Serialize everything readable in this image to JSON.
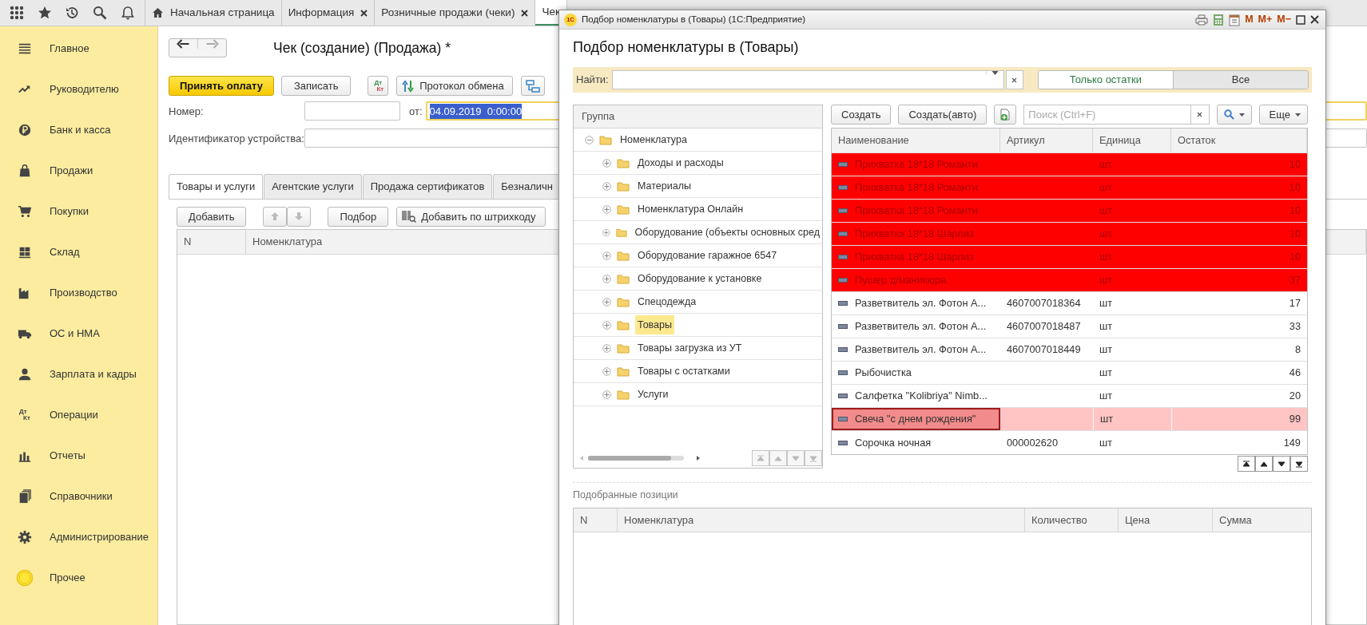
{
  "top_bar": {
    "tabs": [
      {
        "label": "Начальная страница",
        "selected": false,
        "closable": false,
        "home": true
      },
      {
        "label": "Информация",
        "selected": false,
        "closable": true,
        "home": false
      },
      {
        "label": "Розничные продажи (чеки)",
        "selected": false,
        "closable": true,
        "home": false
      },
      {
        "label": "Чек",
        "selected": true,
        "closable": false,
        "home": false
      }
    ]
  },
  "sidebar": {
    "items": [
      {
        "label": "Главное"
      },
      {
        "label": "Руководителю"
      },
      {
        "label": "Банк и касса"
      },
      {
        "label": "Продажи"
      },
      {
        "label": "Покупки"
      },
      {
        "label": "Склад"
      },
      {
        "label": "Производство"
      },
      {
        "label": "ОС и НМА"
      },
      {
        "label": "Зарплата и кадры"
      },
      {
        "label": "Операции",
        "icon_text": [
          "Дт",
          "Кт"
        ]
      },
      {
        "label": "Отчеты"
      },
      {
        "label": "Справочники"
      },
      {
        "label": "Администрирование"
      },
      {
        "label": "Прочее"
      }
    ]
  },
  "form": {
    "title": "Чек (создание) (Продажа) *",
    "commands": [
      {
        "kind": "primary",
        "label": "Принять оплату"
      },
      {
        "kind": "button",
        "label": "Записать"
      },
      {
        "kind": "dtkt",
        "icon_text": [
          "Дт",
          "Кт"
        ]
      },
      {
        "kind": "icon-button",
        "label": "Протокол обмена"
      },
      {
        "kind": "icon"
      }
    ],
    "number_label": "Номер:",
    "date_label": "от:",
    "date_value": "04.09.2019  0:00:00",
    "device_label": "Идентификатор устройства:",
    "tabs": [
      {
        "label": "Товары и услуги",
        "selected": true
      },
      {
        "label": "Агентские услуги",
        "selected": false
      },
      {
        "label": "Продажа сертификатов",
        "selected": false
      },
      {
        "label": "Безналичн",
        "selected": false
      }
    ],
    "table_commands": {
      "add": "Добавить",
      "pick": "Подбор",
      "barcode": "Добавить по штрихкоду"
    },
    "table": {
      "columns": [
        "N",
        "Номенклатура"
      ]
    }
  },
  "dialog": {
    "window_title": "Подбор номенклатуры в  (Товары)  (1С:Предприятие)",
    "logo_text": "1С",
    "memory_buttons": [
      "M",
      "M+",
      "M−"
    ],
    "heading": "Подбор номенклатуры в  (Товары)",
    "find_label": "Найти:",
    "filter_options": [
      {
        "label": "Только остатки",
        "selected": false
      },
      {
        "label": "Все",
        "selected": true
      }
    ],
    "tree": {
      "header": "Группа",
      "root": {
        "label": "Номенклатура",
        "expanded": true,
        "selected": false,
        "children": [
          {
            "label": "Доходы и расходы",
            "expanded": false,
            "selected": false
          },
          {
            "label": "Материалы",
            "expanded": false,
            "selected": false
          },
          {
            "label": "Номенклатура Онлайн",
            "expanded": false,
            "selected": false
          },
          {
            "label": "Оборудование (объекты основных сред",
            "expanded": false,
            "selected": false
          },
          {
            "label": "Оборудование гаражное 6547",
            "expanded": false,
            "selected": false
          },
          {
            "label": "Оборудование к установке",
            "expanded": false,
            "selected": false
          },
          {
            "label": "Спецодежда",
            "expanded": false,
            "selected": false
          },
          {
            "label": "Товары",
            "expanded": false,
            "selected": true
          },
          {
            "label": "Товары загрузка из УТ",
            "expanded": false,
            "selected": false
          },
          {
            "label": "Товары с остатками",
            "expanded": false,
            "selected": false
          },
          {
            "label": "Услуги",
            "expanded": false,
            "selected": false
          }
        ]
      }
    },
    "list": {
      "create": "Создать",
      "create_auto": "Создать(авто)",
      "search_placeholder": "Поиск (Ctrl+F)",
      "more": "Еще",
      "columns": [
        "Наименование",
        "Артикул",
        "Единица",
        "Остаток"
      ],
      "rows": [
        {
          "name": "Прихватка 18*18 Романти",
          "article": "",
          "unit": "шт",
          "stock": "10",
          "color": "#ff0000",
          "selected": false
        },
        {
          "name": "Прихватка 18*18 Романти",
          "article": "",
          "unit": "шт",
          "stock": "10",
          "color": "#ff0000",
          "selected": false
        },
        {
          "name": "Прихватка 18*18 Романти",
          "article": "",
          "unit": "шт",
          "stock": "10",
          "color": "#ff0000",
          "selected": false
        },
        {
          "name": "Прихватка 18*18 Шарлиз",
          "article": "",
          "unit": "шт",
          "stock": "10",
          "color": "#ff0000",
          "selected": false
        },
        {
          "name": "Прихватка 18*18 Шарлиз",
          "article": "",
          "unit": "шт",
          "stock": "10",
          "color": "#ff0000",
          "selected": false
        },
        {
          "name": "Пушер д/маникюра",
          "article": "",
          "unit": "шт",
          "stock": "37",
          "color": "#ff0000",
          "selected": false
        },
        {
          "name": "Разветвитель эл. Фотон А...",
          "article": "4607007018364",
          "unit": "шт",
          "stock": "17",
          "color": "#ffffff",
          "selected": false
        },
        {
          "name": "Разветвитель эл. Фотон А...",
          "article": "4607007018487",
          "unit": "шт",
          "stock": "33",
          "color": "#ffffff",
          "selected": false
        },
        {
          "name": "Разветвитель эл. Фотон А...",
          "article": "4607007018449",
          "unit": "шт",
          "stock": "8",
          "color": "#ffffff",
          "selected": false
        },
        {
          "name": "Рыбочистка",
          "article": "",
          "unit": "шт",
          "stock": "46",
          "color": "#ffffff",
          "selected": false
        },
        {
          "name": "Салфетка \"Kolibriya\" Nimb...",
          "article": "",
          "unit": "шт",
          "stock": "20",
          "color": "#ffffff",
          "selected": false
        },
        {
          "name": "Свеча \"с днем рождения\"",
          "article": "",
          "unit": "шт",
          "stock": "99",
          "color": "#ffc4c4",
          "selected": true
        },
        {
          "name": "Сорочка ночная",
          "article": "000002620",
          "unit": "шт",
          "stock": "149",
          "color": "#ffffff",
          "selected": false
        }
      ]
    },
    "picked": {
      "label": "Подобранные позиции",
      "columns": [
        "N",
        "Номенклатура",
        "Количество",
        "Цена",
        "Сумма"
      ]
    }
  }
}
